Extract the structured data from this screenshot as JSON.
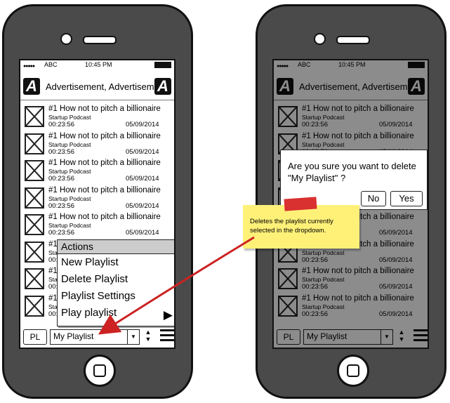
{
  "status": {
    "carrier": "ABC",
    "time": "10:45 PM"
  },
  "ad": {
    "text": "Advertisement, Advertisement",
    "logo_left": "A",
    "logo_right": "A"
  },
  "episodes": [
    {
      "title": "#1 How not to pitch a billionaire",
      "podcast": "Startup Podcast",
      "duration": "00:23:56",
      "date": "05/09/2014"
    },
    {
      "title": "#1 How not to pitch a billionaire",
      "podcast": "Startup Podcast",
      "duration": "00:23:56",
      "date": "05/09/2014"
    },
    {
      "title": "#1 How not to pitch a billionaire",
      "podcast": "Startup Podcast",
      "duration": "00:23:56",
      "date": "05/09/2014"
    },
    {
      "title": "#1 How not to pitch a billionaire",
      "podcast": "Startup Podcast",
      "duration": "00:23:56",
      "date": "05/09/2014"
    },
    {
      "title": "#1 How not to pitch a billionaire",
      "podcast": "Startup Podcast",
      "duration": "00:23:56",
      "date": "05/09/2014"
    },
    {
      "title": "#1 How not to pitch a billionaire",
      "podcast": "Startup Podcast",
      "duration": "00:23:56",
      "date": "05/09/2014"
    },
    {
      "title": "#1 How not to pitch a billionaire",
      "podcast": "Startup Podcast",
      "duration": "00:23:56",
      "date": "05/09/2014"
    },
    {
      "title": "#1 How not to pitch a billionaire",
      "podcast": "Startup Podcast",
      "duration": "00:23:56",
      "date": "05/09/2014"
    }
  ],
  "actions_menu": {
    "header": "Actions",
    "items": [
      "New Playlist",
      "Delete Playlist",
      "Playlist Settings",
      "Play playlist"
    ],
    "play_icon": "play-icon"
  },
  "bottom_bar": {
    "pl_label": "PL",
    "playlist_value": "My Playlist",
    "icons": [
      "chevron-down-icon",
      "up-down-icon",
      "hamburger-menu-icon"
    ]
  },
  "dialog": {
    "message_line1": "Are you sure you want to delete",
    "message_line2": "\"My Playlist\" ?",
    "no_label": "No",
    "yes_label": "Yes"
  },
  "note": {
    "line1": "Deletes the playlist currently",
    "line2": "selected in the dropdown."
  },
  "colors": {
    "note_bg": "#fff178",
    "tape": "#d93030",
    "arrow": "#cc2222",
    "phone_body": "#4a4a4a"
  }
}
